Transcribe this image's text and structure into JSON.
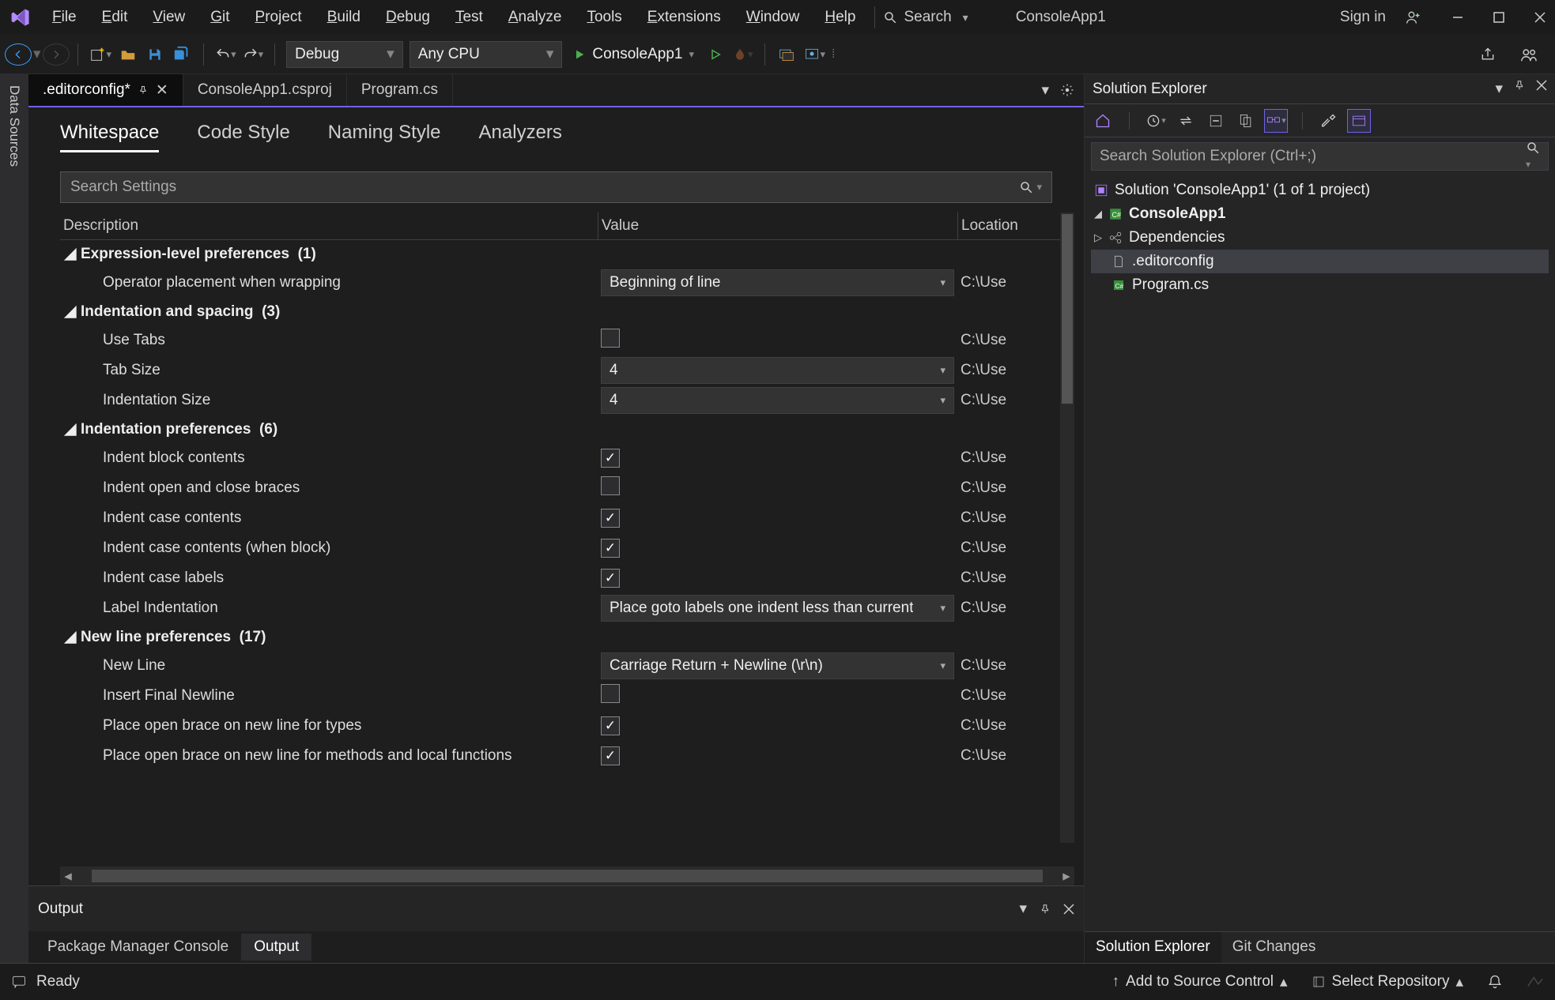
{
  "menubar": [
    "File",
    "Edit",
    "View",
    "Git",
    "Project",
    "Build",
    "Debug",
    "Test",
    "Analyze",
    "Tools",
    "Extensions",
    "Window",
    "Help"
  ],
  "title": {
    "search_label": "Search",
    "app_name": "ConsoleApp1",
    "sign_in": "Sign in"
  },
  "toolbar": {
    "config": "Debug",
    "platform": "Any CPU",
    "run_target": "ConsoleApp1"
  },
  "doc_tabs": [
    {
      "label": ".editorconfig*",
      "active": true,
      "pinned": true,
      "closable": true
    },
    {
      "label": "ConsoleApp1.csproj",
      "active": false
    },
    {
      "label": "Program.cs",
      "active": false
    }
  ],
  "config_tabs": [
    "Whitespace",
    "Code Style",
    "Naming Style",
    "Analyzers"
  ],
  "config_tab_active": 0,
  "search_settings_placeholder": "Search Settings",
  "columns": {
    "desc": "Description",
    "value": "Value",
    "loc": "Location"
  },
  "loc_trunc": "C:\\Use",
  "groups": [
    {
      "title": "Expression-level preferences",
      "count": 1,
      "rows": [
        {
          "label": "Operator placement when wrapping",
          "kind": "dropdown",
          "value": "Beginning of line"
        }
      ]
    },
    {
      "title": "Indentation and spacing",
      "count": 3,
      "rows": [
        {
          "label": "Use Tabs",
          "kind": "check",
          "value": false
        },
        {
          "label": "Tab Size",
          "kind": "dropdown",
          "value": "4"
        },
        {
          "label": "Indentation Size",
          "kind": "dropdown",
          "value": "4"
        }
      ]
    },
    {
      "title": "Indentation preferences",
      "count": 6,
      "rows": [
        {
          "label": "Indent block contents",
          "kind": "check",
          "value": true
        },
        {
          "label": "Indent open and close braces",
          "kind": "check",
          "value": false
        },
        {
          "label": "Indent case contents",
          "kind": "check",
          "value": true
        },
        {
          "label": "Indent case contents (when block)",
          "kind": "check",
          "value": true
        },
        {
          "label": "Indent case labels",
          "kind": "check",
          "value": true
        },
        {
          "label": "Label Indentation",
          "kind": "dropdown",
          "value": "Place goto labels one indent less than current"
        }
      ]
    },
    {
      "title": "New line preferences",
      "count": 17,
      "rows": [
        {
          "label": "New Line",
          "kind": "dropdown",
          "value": "Carriage Return + Newline (\\r\\n)"
        },
        {
          "label": "Insert Final Newline",
          "kind": "check",
          "value": false
        },
        {
          "label": "Place open brace on new line for types",
          "kind": "check",
          "value": true
        },
        {
          "label": "Place open brace on new line for methods and local functions",
          "kind": "check",
          "value": true
        }
      ]
    }
  ],
  "output_panel_title": "Output",
  "bottom_tabs": [
    {
      "label": "Package Manager Console",
      "active": false
    },
    {
      "label": "Output",
      "active": true
    }
  ],
  "left_sidestrip": "Data Sources",
  "solution": {
    "title": "Solution Explorer",
    "search_placeholder": "Search Solution Explorer (Ctrl+;)",
    "root": "Solution 'ConsoleApp1' (1 of 1 project)",
    "project": "ConsoleApp1",
    "dependencies": "Dependencies",
    "editorconfig": ".editorconfig",
    "program": "Program.cs",
    "bottom_tabs": [
      {
        "label": "Solution Explorer",
        "active": true
      },
      {
        "label": "Git Changes",
        "active": false
      }
    ]
  },
  "status": {
    "ready": "Ready",
    "add_source": "Add to Source Control",
    "select_repo": "Select Repository"
  }
}
